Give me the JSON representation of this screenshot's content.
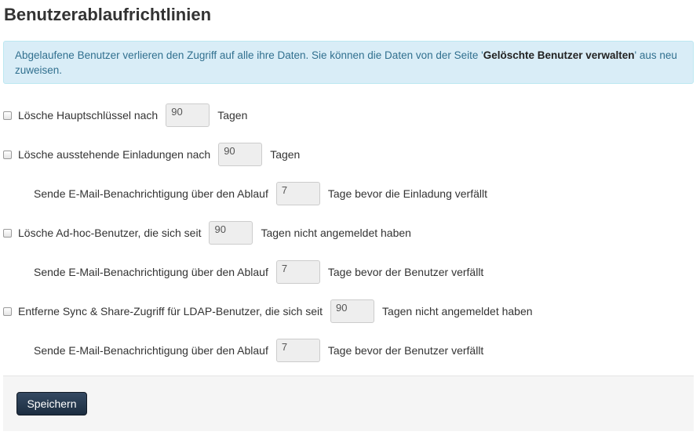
{
  "page": {
    "title": "Benutzerablaufrichtlinien"
  },
  "info": {
    "text_prefix": "Abgelaufene Benutzer verlieren den Zugriff auf alle ihre Daten. Sie können die Daten von der Seite '",
    "link_text": "Gelöschte Benutzer verwalten",
    "text_suffix": "' aus neu zuweisen."
  },
  "rules": {
    "master_key": {
      "checked": false,
      "label": "Lösche Hauptschlüssel nach",
      "value": "90",
      "unit": "Tagen"
    },
    "pending_invites": {
      "checked": false,
      "label": "Lösche ausstehende Einladungen nach",
      "value": "90",
      "unit": "Tagen",
      "notify_label": "Sende E-Mail-Benachrichtigung über den Ablauf",
      "notify_value": "7",
      "notify_unit": "Tage bevor die Einladung verfällt"
    },
    "adhoc_users": {
      "checked": false,
      "label": "Lösche Ad-hoc-Benutzer, die sich seit",
      "value": "90",
      "unit": "Tagen nicht angemeldet haben",
      "notify_label": "Sende E-Mail-Benachrichtigung über den Ablauf",
      "notify_value": "7",
      "notify_unit": "Tage bevor der Benutzer verfällt"
    },
    "ldap_users": {
      "checked": false,
      "label": "Entferne Sync & Share-Zugriff für LDAP-Benutzer, die sich seit",
      "value": "90",
      "unit": "Tagen nicht angemeldet haben",
      "notify_label": "Sende E-Mail-Benachrichtigung über den Ablauf",
      "notify_value": "7",
      "notify_unit": "Tage bevor der Benutzer verfällt"
    }
  },
  "footer": {
    "save_label": "Speichern"
  }
}
